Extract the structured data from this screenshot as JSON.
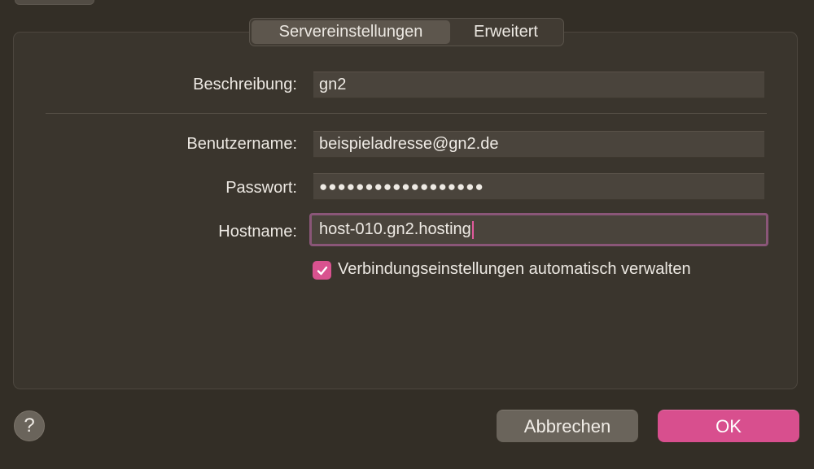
{
  "tabs": [
    {
      "label": "Servereinstellungen",
      "selected": true
    },
    {
      "label": "Erweitert",
      "selected": false
    }
  ],
  "form": {
    "description": {
      "label": "Beschreibung:",
      "value": "gn2"
    },
    "username": {
      "label": "Benutzername:",
      "value": "beispieladresse@gn2.de"
    },
    "password": {
      "label": "Passwort:",
      "masked_value": "●●●●●●●●●●●●●●●●●●"
    },
    "hostname": {
      "label": "Hostname:",
      "value": "host-010.gn2.hosting"
    },
    "auto_manage": {
      "label": "Verbindungseinstellungen automatisch verwalten",
      "checked": true
    }
  },
  "footer": {
    "help_label": "?",
    "cancel_label": "Abbrechen",
    "ok_label": "OK"
  },
  "colors": {
    "accent": "#d84f8e",
    "background": "#332e26",
    "panel": "#3a352d",
    "field": "#4a443c"
  },
  "icons": {
    "checkbox": "checkmark-icon",
    "help": "question-mark-icon"
  }
}
